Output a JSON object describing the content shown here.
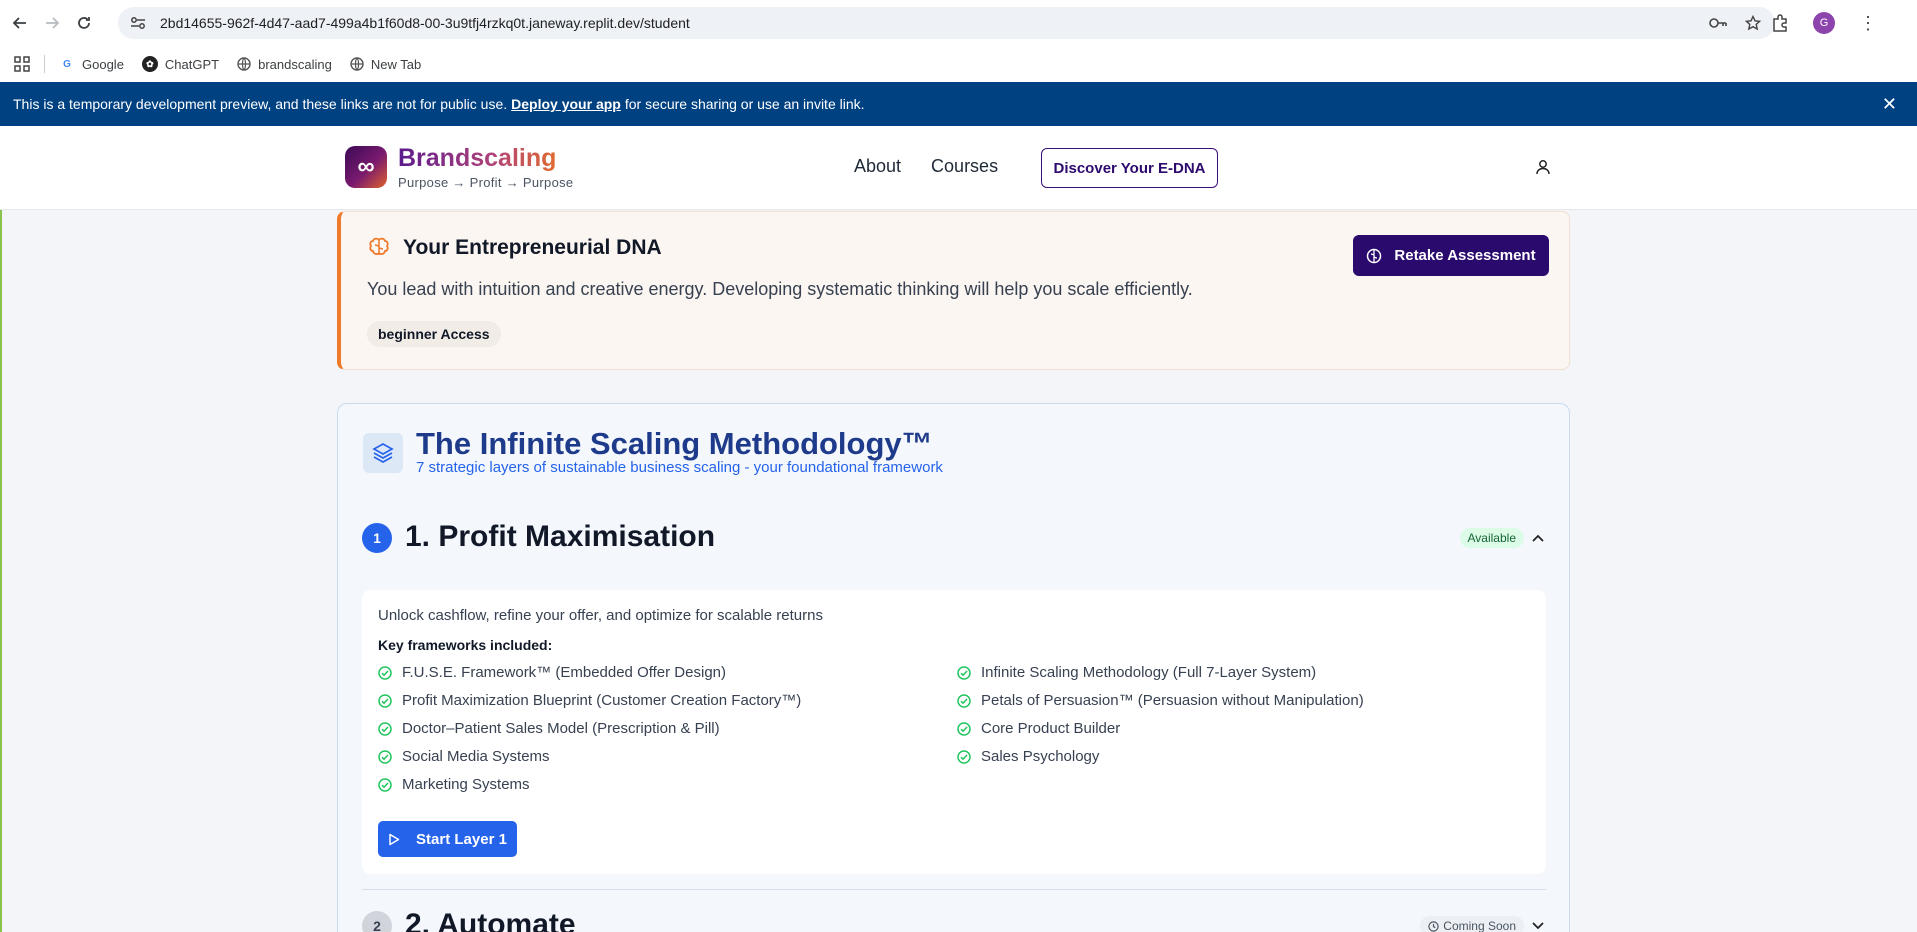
{
  "browser": {
    "url": "2bd14655-962f-4d47-aad7-499a4b1f60d8-00-3u9tfj4rzkq0t.janeway.replit.dev/student",
    "profile_initial": "G",
    "bookmarks": [
      {
        "label": "Google",
        "icon": "google-icon"
      },
      {
        "label": "ChatGPT",
        "icon": "chatgpt-icon"
      },
      {
        "label": "brandscaling",
        "icon": "globe-icon"
      },
      {
        "label": "New Tab",
        "icon": "globe-icon"
      }
    ]
  },
  "dev_banner": {
    "text_before": "This is a temporary development preview, and these links are not for public use.",
    "link": "Deploy your app",
    "text_after": "for secure sharing or use an invite link."
  },
  "header": {
    "brand": "Brandscaling",
    "tagline": "Purpose → Profit → Purpose",
    "logo_glyph": "∞",
    "nav": [
      "About",
      "Courses"
    ],
    "cta": "Discover Your E-DNA"
  },
  "dna_card": {
    "title": "Your Entrepreneurial DNA",
    "description": "You lead with intuition and creative energy. Developing systematic thinking will help you scale efficiently.",
    "badge": "beginner Access",
    "retake_button": "Retake Assessment",
    "accent_color": "#f07a2b"
  },
  "methodology": {
    "title": "The Infinite Scaling Methodology™",
    "subtitle": "7 strategic layers of sustainable business scaling - your foundational framework",
    "layers": [
      {
        "number": "1",
        "title": "1. Profit Maximisation",
        "status": "Available",
        "expanded": true,
        "description": "Unlock cashflow, refine your offer, and optimize for scalable returns",
        "frameworks_label": "Key frameworks included:",
        "frameworks": [
          "F.U.S.E. Framework™ (Embedded Offer Design)",
          "Infinite Scaling Methodology (Full 7-Layer System)",
          "Profit Maximization Blueprint (Customer Creation Factory™)",
          "Petals of Persuasion™ (Persuasion without Manipulation)",
          "Doctor–Patient Sales Model (Prescription & Pill)",
          "Core Product Builder",
          "Social Media Systems",
          "Sales Psychology",
          "Marketing Systems"
        ],
        "button": "Start Layer 1"
      },
      {
        "number": "2",
        "title": "2. Automate",
        "status": "Coming Soon",
        "expanded": false
      }
    ]
  },
  "colors": {
    "banner": "#004182",
    "primary_blue": "#2563eb",
    "deep_purple": "#2b0a6e",
    "available_green": "#dcfce7",
    "check_green": "#22c55e"
  }
}
